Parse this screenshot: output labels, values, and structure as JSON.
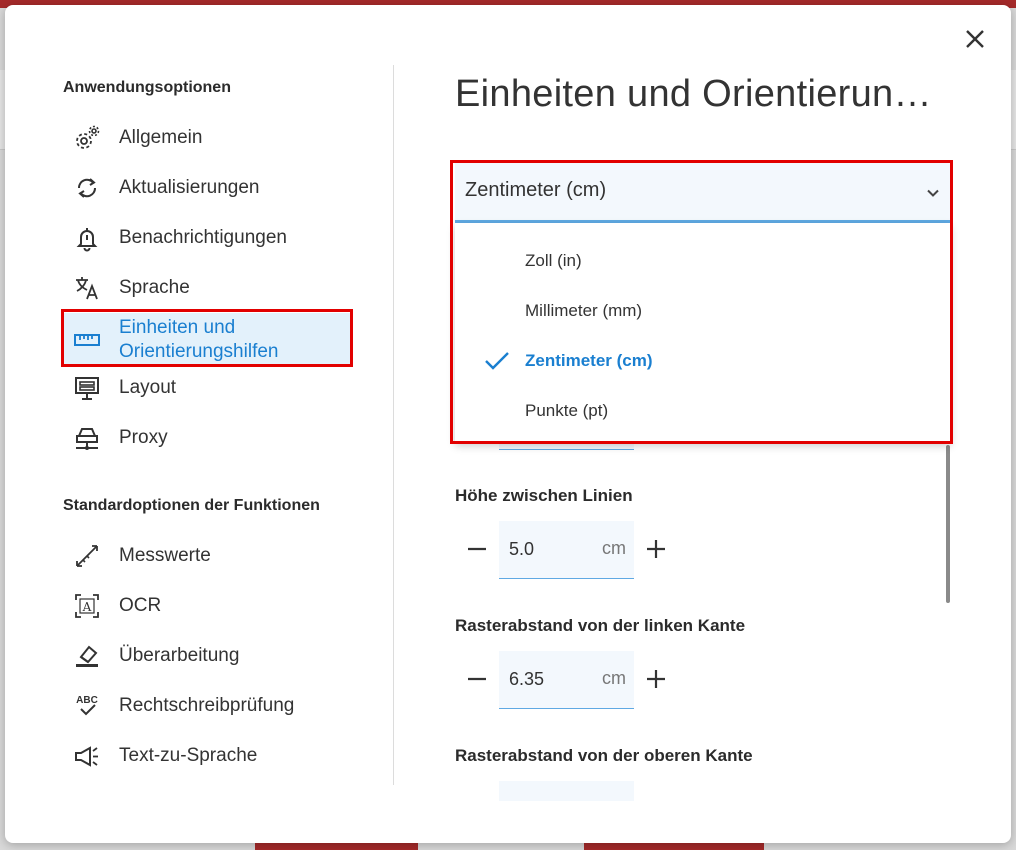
{
  "dialog": {
    "close_label": "close"
  },
  "sidebar": {
    "section1_title": "Anwendungsoptionen",
    "section1_items": [
      {
        "label": "Allgemein",
        "icon": "gear-icon"
      },
      {
        "label": "Aktualisierungen",
        "icon": "sync-icon"
      },
      {
        "label": "Benachrichtigungen",
        "icon": "bell-icon"
      },
      {
        "label": "Sprache",
        "icon": "translate-icon"
      },
      {
        "label": "Einheiten und Orientierungshilfen",
        "label_line1": "Einheiten und",
        "label_line2": "Orientierungshilfen",
        "icon": "ruler-icon",
        "active": true
      },
      {
        "label": "Layout",
        "icon": "layout-icon"
      },
      {
        "label": "Proxy",
        "icon": "proxy-icon"
      }
    ],
    "section2_title": "Standardoptionen der Funktionen",
    "section2_items": [
      {
        "label": "Messwerte",
        "icon": "measure-icon"
      },
      {
        "label": "OCR",
        "icon": "ocr-icon"
      },
      {
        "label": "Überarbeitung",
        "icon": "eraser-icon"
      },
      {
        "label": "Rechtschreibprüfung",
        "icon": "spellcheck-icon"
      },
      {
        "label": "Text-zu-Sprache",
        "icon": "megaphone-icon"
      }
    ]
  },
  "content": {
    "title": "Einheiten und Orientierun…",
    "unit_select": {
      "value": "Zentimeter (cm)",
      "options": [
        {
          "label": "Zoll (in)",
          "selected": false
        },
        {
          "label": "Millimeter (mm)",
          "selected": false
        },
        {
          "label": "Zentimeter (cm)",
          "selected": true
        },
        {
          "label": "Punkte (pt)",
          "selected": false
        }
      ]
    },
    "fields": [
      {
        "label": "Höhe zwischen Linien",
        "value": "5.0",
        "unit": "cm"
      },
      {
        "label": "Rasterabstand von der linken Kante",
        "value": "6.35",
        "unit": "cm"
      },
      {
        "label": "Rasterabstand von der oberen Kante"
      }
    ]
  },
  "colors": {
    "accent": "#1a7fd0",
    "highlight": "#e20000",
    "field_bg": "#f3f8fd"
  }
}
